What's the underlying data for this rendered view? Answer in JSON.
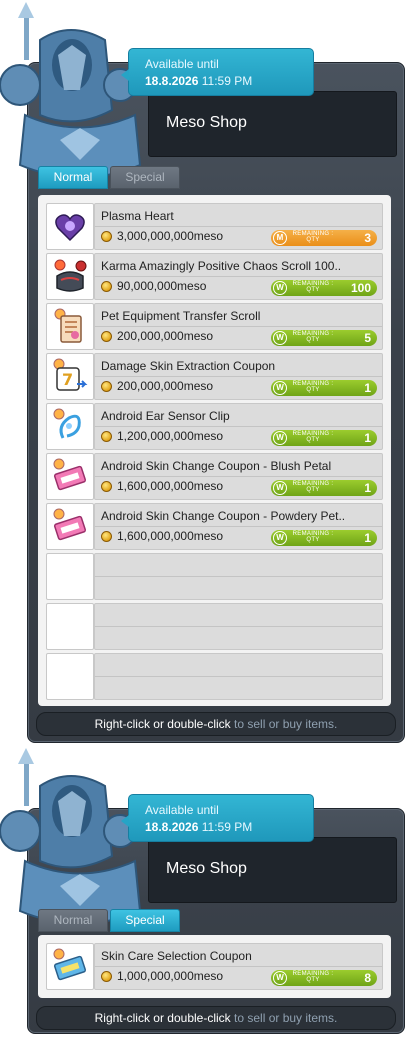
{
  "colors": {
    "accent": "#27a6c9",
    "qty_orange": "#ee9a25",
    "qty_green": "#84b624"
  },
  "shop1": {
    "availability": {
      "line1": "Available until",
      "date": "18.8.2026",
      "time": "11:59 PM"
    },
    "title": "Meso Shop",
    "tabs": [
      {
        "label": "Normal",
        "active": true
      },
      {
        "label": "Special",
        "active": false
      }
    ],
    "items": [
      {
        "name": "Plasma Heart",
        "price": "3,000,000,000meso",
        "badge": "M",
        "qty_label_1": "REMAINING",
        "qty_label_2": "QTY",
        "qty": "3",
        "qty_color": "orange",
        "icon": "plasma-heart-icon"
      },
      {
        "name": "Karma Amazingly Positive Chaos Scroll 100..",
        "price": "90,000,000meso",
        "badge": "W",
        "qty_label_1": "REMAINING",
        "qty_label_2": "QTY",
        "qty": "100",
        "qty_color": "green",
        "icon": "chaos-scroll-icon"
      },
      {
        "name": "Pet Equipment Transfer Scroll",
        "price": "200,000,000meso",
        "badge": "W",
        "qty_label_1": "REMAINING",
        "qty_label_2": "QTY",
        "qty": "5",
        "qty_color": "green",
        "icon": "pet-scroll-icon"
      },
      {
        "name": "Damage Skin Extraction Coupon",
        "price": "200,000,000meso",
        "badge": "W",
        "qty_label_1": "REMAINING",
        "qty_label_2": "QTY",
        "qty": "1",
        "qty_color": "green",
        "icon": "damage-skin-coupon-icon"
      },
      {
        "name": "Android Ear Sensor Clip",
        "price": "1,200,000,000meso",
        "badge": "W",
        "qty_label_1": "REMAINING",
        "qty_label_2": "QTY",
        "qty": "1",
        "qty_color": "green",
        "icon": "ear-sensor-clip-icon"
      },
      {
        "name": "Android Skin Change Coupon - Blush Petal",
        "price": "1,600,000,000meso",
        "badge": "W",
        "qty_label_1": "REMAINING",
        "qty_label_2": "QTY",
        "qty": "1",
        "qty_color": "green",
        "icon": "skin-coupon-pink-icon"
      },
      {
        "name": "Android Skin Change Coupon - Powdery Pet..",
        "price": "1,600,000,000meso",
        "badge": "W",
        "qty_label_1": "REMAINING",
        "qty_label_2": "QTY",
        "qty": "1",
        "qty_color": "green",
        "icon": "skin-coupon-pink-icon"
      }
    ],
    "footer": {
      "part1": "Right-click",
      "part2": " or ",
      "part3": "double-click",
      "part4": " to sell or buy items."
    }
  },
  "shop2": {
    "availability": {
      "line1": "Available until",
      "date": "18.8.2026",
      "time": "11:59 PM"
    },
    "title": "Meso Shop",
    "tabs": [
      {
        "label": "Normal",
        "active": false
      },
      {
        "label": "Special",
        "active": true
      }
    ],
    "items": [
      {
        "name": "Skin Care Selection Coupon",
        "price": "1,000,000,000meso",
        "badge": "W",
        "qty_label_1": "REMAINING",
        "qty_label_2": "QTY",
        "qty": "8",
        "qty_color": "green",
        "icon": "skin-care-coupon-icon"
      }
    ],
    "footer": {
      "part1": "Right-click",
      "part2": " or ",
      "part3": "double-click",
      "part4": " to sell or buy items."
    }
  }
}
